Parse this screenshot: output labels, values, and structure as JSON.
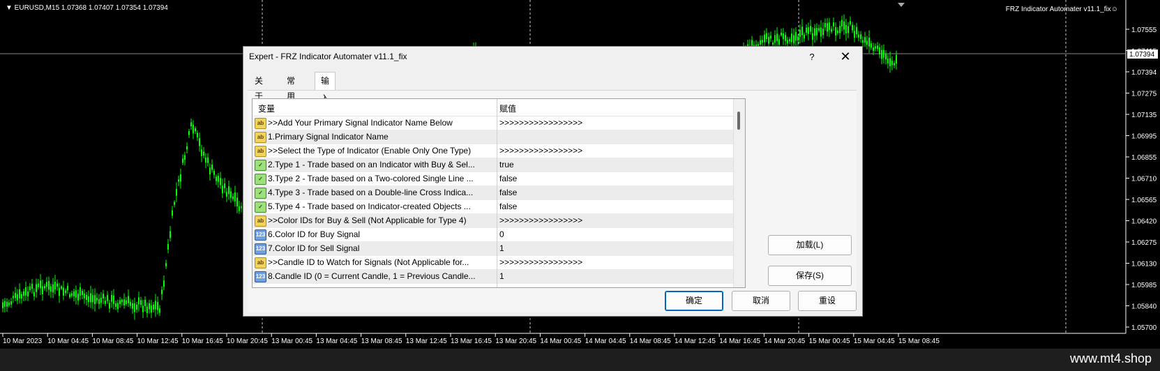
{
  "chart": {
    "symbol_info": "▼ EURUSD,M15  1.07368 1.07407 1.07354 1.07394",
    "ea_label": "FRZ Indicator Automater v11.1_fix☺",
    "price_labels": [
      "1.07555",
      "1.07415",
      "1.07394",
      "1.07275",
      "1.07135",
      "1.06995",
      "1.06855",
      "1.06710",
      "1.06565",
      "1.06420",
      "1.06275",
      "1.06130",
      "1.05985",
      "1.05840",
      "1.05700"
    ],
    "time_labels": [
      "10 Mar 2023",
      "10 Mar 04:45",
      "10 Mar 08:45",
      "10 Mar 12:45",
      "10 Mar 16:45",
      "10 Mar 20:45",
      "13 Mar 00:45",
      "13 Mar 04:45",
      "13 Mar 08:45",
      "13 Mar 12:45",
      "13 Mar 16:45",
      "13 Mar 20:45",
      "14 Mar 00:45",
      "14 Mar 04:45",
      "14 Mar 08:45",
      "14 Mar 12:45",
      "14 Mar 16:45",
      "14 Mar 20:45",
      "15 Mar 00:45",
      "15 Mar 04:45",
      "15 Mar 08:45"
    ],
    "current_price": "1.07394",
    "colors": {
      "background": "#000000",
      "candles": "#00ff00",
      "grid": "#ffffff"
    }
  },
  "watermark": "www.mt4.shop",
  "dialog": {
    "title": "Expert - FRZ Indicator Automater v11.1_fix",
    "help": "?",
    "close": "✕",
    "tabs": [
      "关于",
      "常用",
      "输入参数"
    ],
    "active_tab": "输入参数",
    "grid": {
      "headers": {
        "variable": "变量",
        "value": "赋值"
      },
      "rows": [
        {
          "type": "string",
          "name": ">>Add Your Primary Signal Indicator Name Below",
          "value": ">>>>>>>>>>>>>>>>>"
        },
        {
          "type": "string",
          "name": "1.Primary Signal Indicator Name",
          "value": ""
        },
        {
          "type": "string",
          "name": ">>Select the Type of Indicator (Enable Only One Type)",
          "value": ">>>>>>>>>>>>>>>>>"
        },
        {
          "type": "bool",
          "name": "2.Type 1 - Trade based on an Indicator with Buy & Sel...",
          "value": "true"
        },
        {
          "type": "bool",
          "name": "3.Type 2 - Trade based on a Two-colored Single Line ...",
          "value": "false"
        },
        {
          "type": "bool",
          "name": "4.Type 3 - Trade based on a Double-line Cross Indica...",
          "value": "false"
        },
        {
          "type": "bool",
          "name": "5.Type 4 - Trade based on Indicator-created Objects ...",
          "value": "false"
        },
        {
          "type": "string",
          "name": ">>Color IDs for Buy & Sell (Not Applicable for Type 4)",
          "value": ">>>>>>>>>>>>>>>>>"
        },
        {
          "type": "int",
          "name": "6.Color ID for Buy Signal",
          "value": "0"
        },
        {
          "type": "int",
          "name": "7.Color ID for Sell Signal",
          "value": "1"
        },
        {
          "type": "string",
          "name": ">>Candle ID to Watch for Signals  (Not Applicable for...",
          "value": ">>>>>>>>>>>>>>>>>"
        },
        {
          "type": "int",
          "name": "8.Candle ID (0 = Current Candle, 1 = Previous Candle...",
          "value": "1"
        }
      ]
    },
    "buttons": {
      "load": "加载(L)",
      "save": "保存(S)",
      "ok": "确定",
      "cancel": "取消",
      "reset": "重设"
    },
    "icons": {
      "string": "ab",
      "bool": "✓",
      "int": "123"
    }
  }
}
